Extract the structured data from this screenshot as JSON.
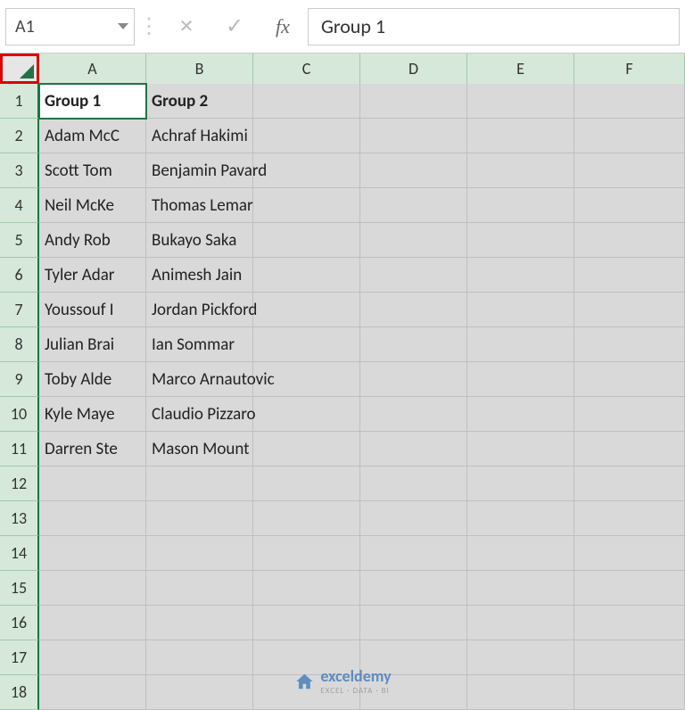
{
  "name_box": "A1",
  "formula_value": "Group 1",
  "columns": [
    "A",
    "B",
    "C",
    "D",
    "E",
    "F"
  ],
  "rows": [
    1,
    2,
    3,
    4,
    5,
    6,
    7,
    8,
    9,
    10,
    11,
    12,
    13,
    14,
    15,
    16,
    17,
    18
  ],
  "cells": {
    "A1": {
      "v": "Group 1",
      "bold": true,
      "active": true
    },
    "B1": {
      "v": "Group 2",
      "bold": true
    },
    "A2": {
      "v": "Adam McC"
    },
    "B2": {
      "v": "Achraf Hakimi",
      "overflow": true
    },
    "A3": {
      "v": "Scott Tom"
    },
    "B3": {
      "v": "Benjamin Pavard",
      "overflow": true
    },
    "A4": {
      "v": "Neil McKe"
    },
    "B4": {
      "v": "Thomas Lemar",
      "overflow": true
    },
    "A5": {
      "v": "Andy Rob"
    },
    "B5": {
      "v": "Bukayo Saka"
    },
    "A6": {
      "v": "Tyler Adar"
    },
    "B6": {
      "v": "Animesh Jain",
      "overflow": true
    },
    "A7": {
      "v": "Youssouf I"
    },
    "B7": {
      "v": "Jordan Pickford",
      "overflow": true
    },
    "A8": {
      "v": "Julian Brai"
    },
    "B8": {
      "v": "Ian Sommar"
    },
    "A9": {
      "v": "Toby Alde"
    },
    "B9": {
      "v": "Marco Arnautovic",
      "overflow": true
    },
    "A10": {
      "v": "Kyle Maye"
    },
    "B10": {
      "v": "Claudio Pizzaro",
      "overflow": true
    },
    "A11": {
      "v": "Darren Ste"
    },
    "B11": {
      "v": "Mason Mount",
      "overflow": true
    }
  },
  "watermark": {
    "brand": "exceldemy",
    "sub": "EXCEL · DATA · BI"
  }
}
